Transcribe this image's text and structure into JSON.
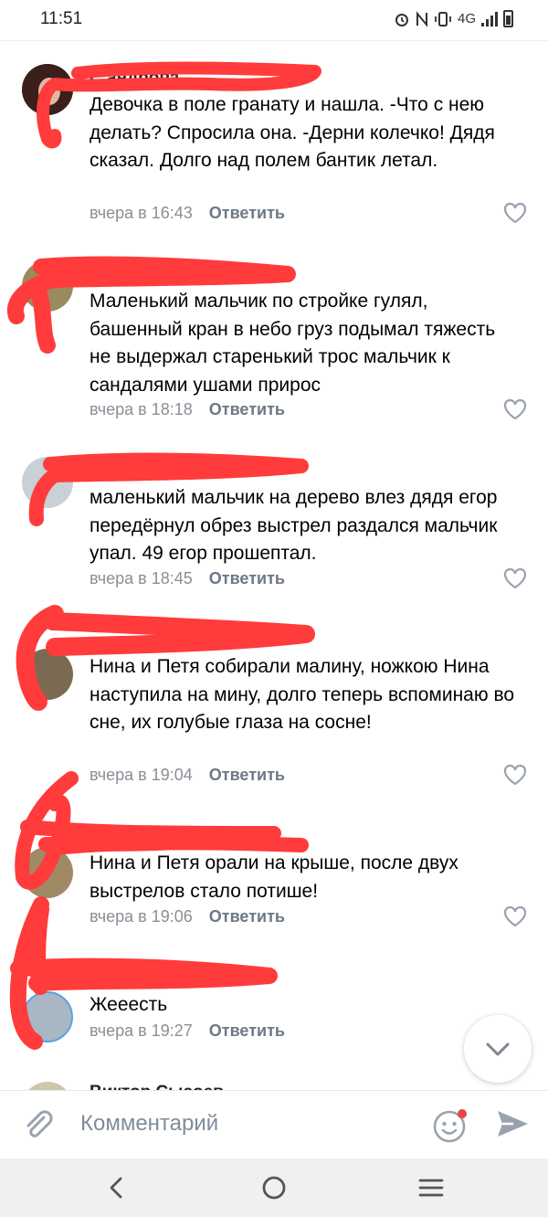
{
  "status": {
    "time": "11:51",
    "network": "4G"
  },
  "comments": [
    {
      "author": "С            андрова",
      "text": "Девочка в поле гранату и нашла. -Что с нею делать? Спросила она. -Дерни колечко! Дядя сказал. Долго над полем бантик летал.",
      "time": "вчера в 16:43",
      "reply": "Ответить"
    },
    {
      "author": "",
      "text": "Маленький мальчик по стройке гулял, башенный кран в небо груз подымал тяжесть не выдержал старенький трос мальчик к сандалями ушами прирос",
      "time": "вчера в 18:18",
      "reply": "Ответить"
    },
    {
      "author": "",
      "text": "маленький мальчик на дерево влез дядя егор передёрнул обрез выстрел раздался мальчик упал. 49 егор прошептал.",
      "time": "вчера в 18:45",
      "reply": "Ответить"
    },
    {
      "author": "",
      "text": "Нина и Петя собирали малину, ножкою Нина наступила на мину, долго теперь вспоминаю во сне, их голубые глаза на сосне!",
      "time": "вчера в 19:04",
      "reply": "Ответить"
    },
    {
      "author": "",
      "text": "Нина и Петя орали на крыше, после двух выстрелов стало потише!",
      "time": "вчера в 19:06",
      "reply": "Ответить"
    },
    {
      "author": "",
      "text": "Жееесть",
      "time": "вчера в 19:27",
      "reply": "Ответить"
    },
    {
      "author": "Виктор Сысоев",
      "text": "",
      "time": "",
      "reply": ""
    }
  ],
  "composer": {
    "placeholder": "Комментарий"
  },
  "colors": {
    "accent": "#2d81e0",
    "scribble": "#ff3b3b",
    "meta": "#8a8f96",
    "notification_dot": "#e64646"
  },
  "icons": [
    "alarm-icon",
    "nfc-icon",
    "vibrate-icon",
    "signal-icon",
    "battery-icon",
    "like-heart-icon",
    "chevron-down-icon",
    "attach-icon",
    "emoji-icon",
    "send-icon",
    "nav-back-icon",
    "nav-home-icon",
    "nav-menu-icon"
  ]
}
